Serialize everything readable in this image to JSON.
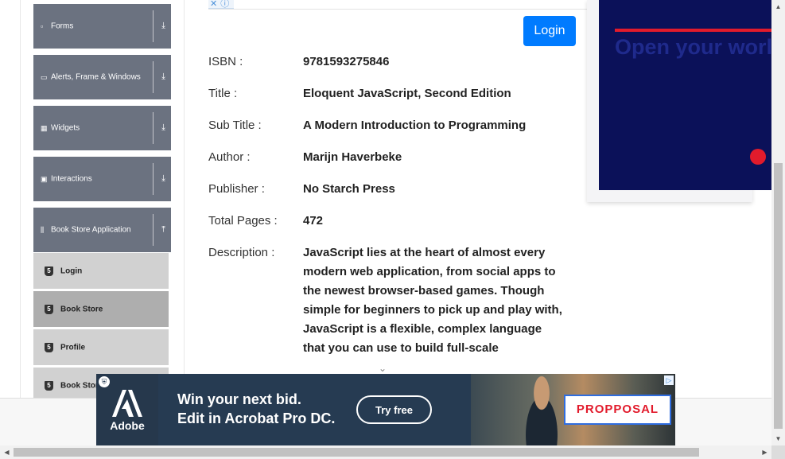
{
  "sidebar": {
    "groups": [
      {
        "label": "Forms",
        "icon": "form-icon",
        "arrow": "download-arrow-icon"
      },
      {
        "label": "Alerts, Frame & Windows",
        "icon": "window-icon",
        "arrow": "download-arrow-icon"
      },
      {
        "label": "Widgets",
        "icon": "grid-icon",
        "arrow": "download-arrow-icon"
      },
      {
        "label": "Interactions",
        "icon": "interaction-icon",
        "arrow": "download-arrow-icon"
      },
      {
        "label": "Book Store Application",
        "icon": "book-stack-icon",
        "arrow": "upload-arrow-icon"
      }
    ],
    "subitems": [
      {
        "label": "Login",
        "active": false
      },
      {
        "label": "Book Store",
        "active": true
      },
      {
        "label": "Profile",
        "active": false
      },
      {
        "label": "Book Store API",
        "active": false
      }
    ]
  },
  "header": {
    "login_label": "Login"
  },
  "book": {
    "rows": [
      {
        "label": "ISBN :",
        "value": "9781593275846"
      },
      {
        "label": "Title :",
        "value": "Eloquent JavaScript, Second Edition"
      },
      {
        "label": "Sub Title :",
        "value": "A Modern Introduction to Programming"
      },
      {
        "label": "Author :",
        "value": "Marijn Haverbeke"
      },
      {
        "label": "Publisher :",
        "value": "No Starch Press"
      },
      {
        "label": "Total Pages :",
        "value": "472"
      },
      {
        "label": "Description :",
        "value": "JavaScript lies at the heart of almost every modern web application, from social apps to the newest browser-based games. Though simple for beginners to pick up and play with, JavaScript is a flexible, complex language that you can use to build full-scale"
      }
    ]
  },
  "ad_right": {
    "headline": "Open your world to greater career opportunities"
  },
  "ad_bottom": {
    "brand": "Adobe",
    "headline_line1": "Win your next bid.",
    "headline_line2": "Edit in Acrobat Pro DC.",
    "cta": "Try free",
    "proposal": "PROPPOSAL"
  },
  "colors": {
    "primary": "#007bff",
    "sidebar_group": "#6b7280",
    "ad_navy": "#0b1159",
    "ad_red": "#e21b2c"
  }
}
